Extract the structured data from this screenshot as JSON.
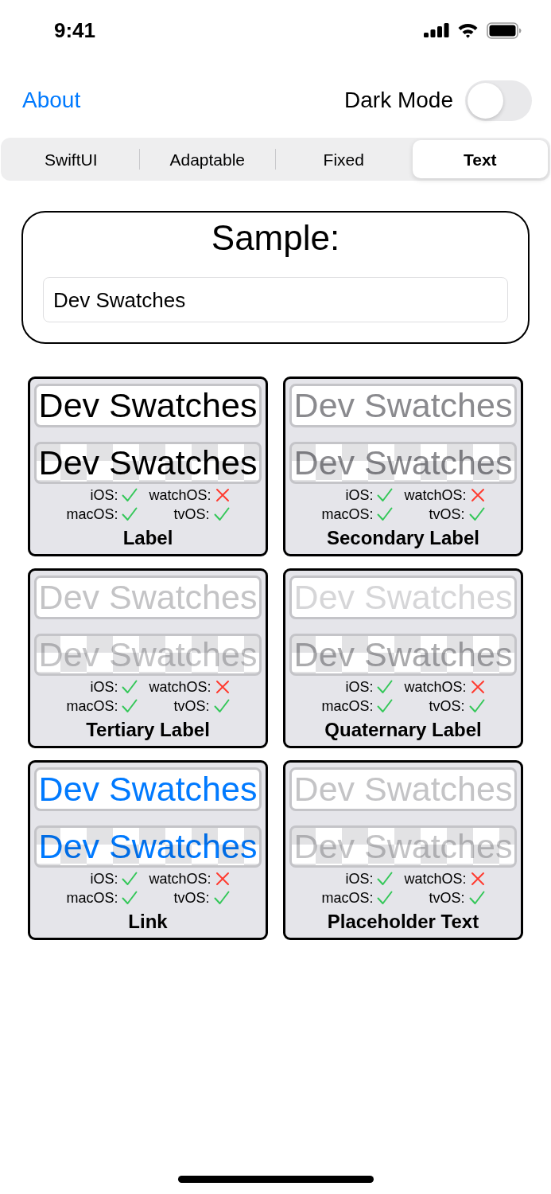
{
  "status_bar": {
    "time": "9:41"
  },
  "nav": {
    "about_link": "About",
    "dark_mode": {
      "label": "Dark Mode",
      "on": false
    }
  },
  "tabs": [
    {
      "label": "SwiftUI",
      "selected": false
    },
    {
      "label": "Adaptable",
      "selected": false
    },
    {
      "label": "Fixed",
      "selected": false
    },
    {
      "label": "Text",
      "selected": true
    }
  ],
  "sample": {
    "title": "Sample:",
    "field_value": "Dev Swatches"
  },
  "swatches": [
    {
      "name": "Label",
      "color": "#000000",
      "preview_text": "Dev Swatches",
      "checker_text": "Dev Swatches",
      "platforms": [
        {
          "name": "iOS:",
          "supported": true
        },
        {
          "name": "watchOS:",
          "supported": false
        },
        {
          "name": "macOS:",
          "supported": true
        },
        {
          "name": "tvOS:",
          "supported": true
        }
      ]
    },
    {
      "name": "Secondary Label",
      "color": "#8a8a8e",
      "preview_text": "Dev Swatches",
      "checker_text": "Dev Swatches",
      "platforms": [
        {
          "name": "iOS:",
          "supported": true
        },
        {
          "name": "watchOS:",
          "supported": false
        },
        {
          "name": "macOS:",
          "supported": true
        },
        {
          "name": "tvOS:",
          "supported": true
        }
      ]
    },
    {
      "name": "Tertiary Label",
      "color": "#c4c4c6",
      "preview_text": "Dev Swatches",
      "checker_text": "Dev Swatches",
      "platforms": [
        {
          "name": "iOS:",
          "supported": true
        },
        {
          "name": "watchOS:",
          "supported": false
        },
        {
          "name": "macOS:",
          "supported": true
        },
        {
          "name": "tvOS:",
          "supported": true
        }
      ]
    },
    {
      "name": "Quaternary Label",
      "color": "#d6d6d8",
      "preview_text": "Dev Swatches",
      "checker_text": "Dev Swatches",
      "platforms": [
        {
          "name": "iOS:",
          "supported": true
        },
        {
          "name": "watchOS:",
          "supported": false
        },
        {
          "name": "macOS:",
          "supported": true
        },
        {
          "name": "tvOS:",
          "supported": true
        }
      ]
    },
    {
      "name": "Link",
      "color": "#007aff",
      "preview_text": "Dev Swatches",
      "checker_text": "Dev Swatches",
      "platforms": [
        {
          "name": "iOS:",
          "supported": true
        },
        {
          "name": "watchOS:",
          "supported": false
        },
        {
          "name": "macOS:",
          "supported": true
        },
        {
          "name": "tvOS:",
          "supported": true
        }
      ]
    },
    {
      "name": "Placeholder Text",
      "color": "#c4c4c6",
      "preview_text": "Dev Swatches",
      "checker_text": "Dev Swatches",
      "platforms": [
        {
          "name": "iOS:",
          "supported": true
        },
        {
          "name": "watchOS:",
          "supported": false
        },
        {
          "name": "macOS:",
          "supported": true
        },
        {
          "name": "tvOS:",
          "supported": true
        }
      ]
    }
  ]
}
